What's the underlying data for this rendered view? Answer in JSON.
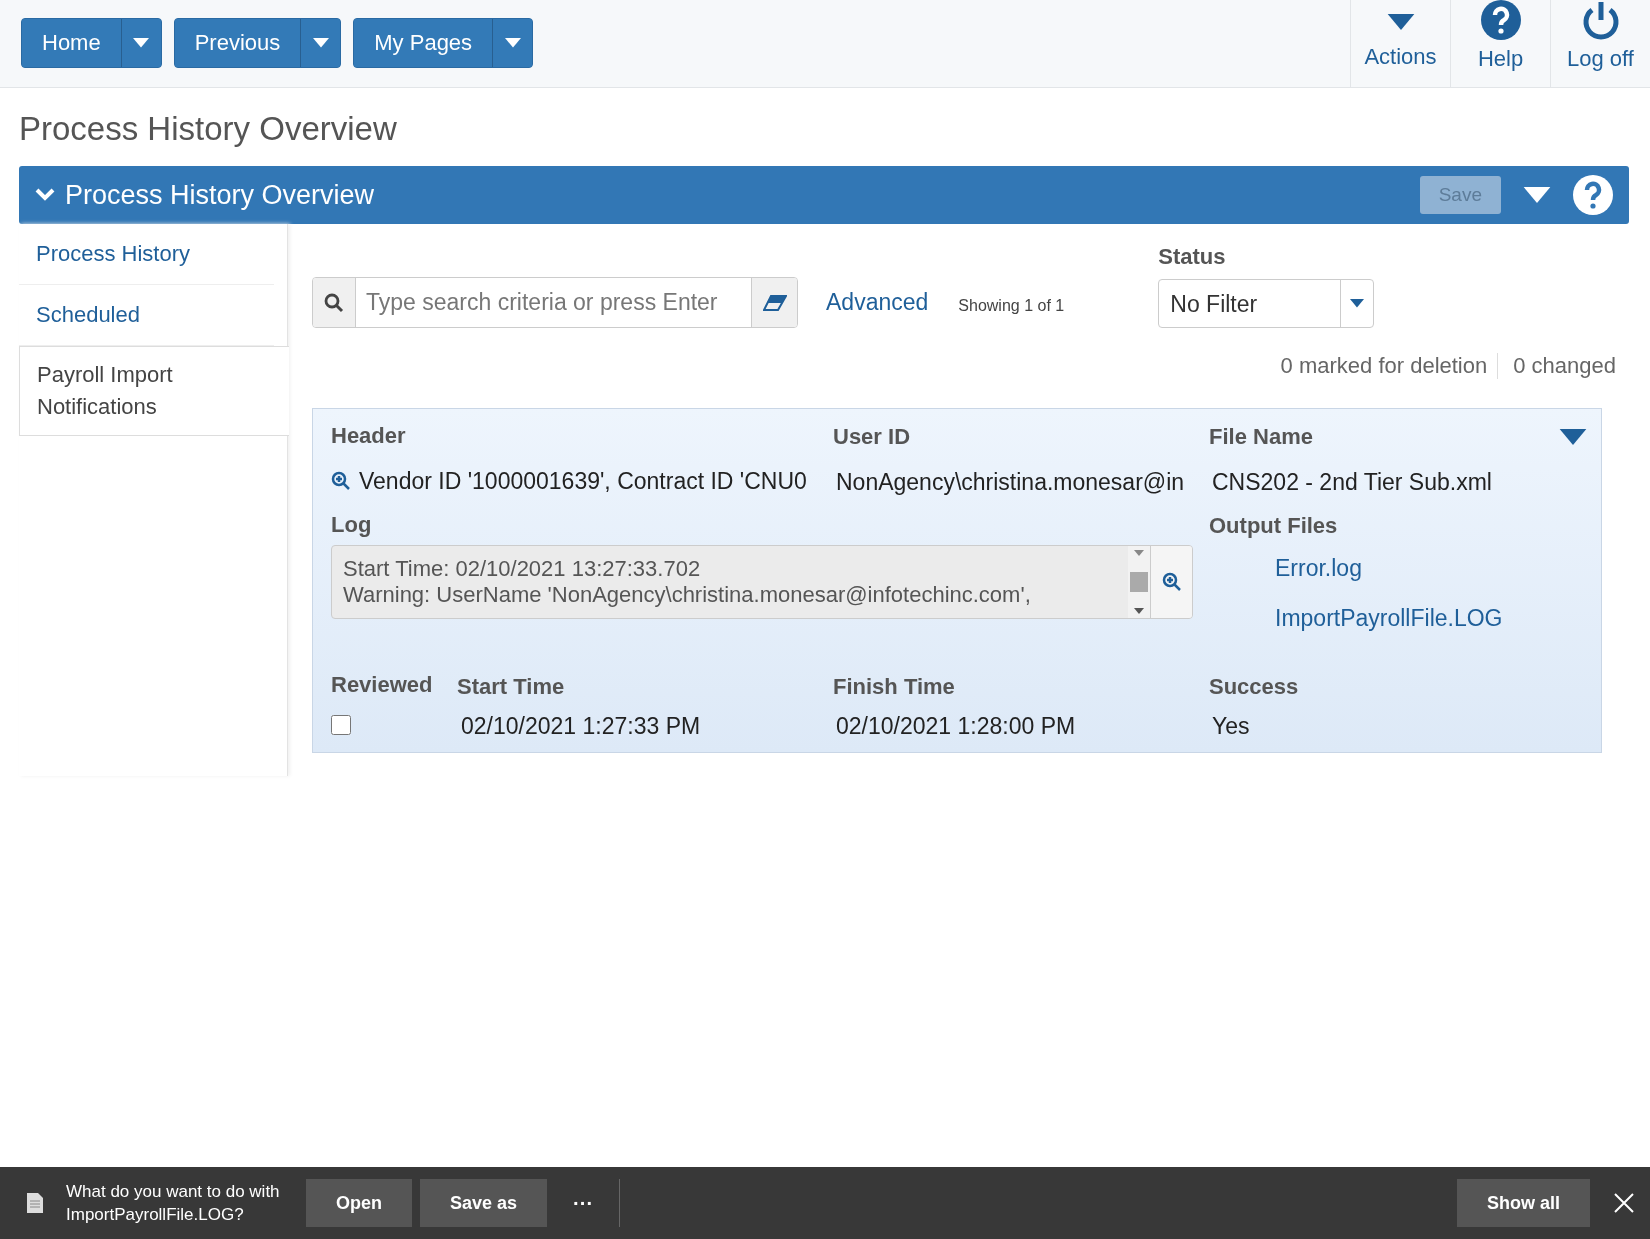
{
  "nav_buttons": [
    {
      "label": "Home"
    },
    {
      "label": "Previous"
    },
    {
      "label": "My Pages"
    }
  ],
  "top_actions": [
    {
      "kind": "caret",
      "label": "Actions"
    },
    {
      "kind": "help",
      "label": "Help"
    },
    {
      "kind": "power",
      "label": "Log off"
    }
  ],
  "page_title": "Process History Overview",
  "panel": {
    "title": "Process History Overview",
    "expanded": true,
    "save_label": "Save",
    "save_disabled": true
  },
  "sidebar": {
    "items": [
      {
        "label": "Process History",
        "selected": false
      },
      {
        "label": "Scheduled",
        "selected": false
      },
      {
        "label": "Payroll Import Notifications",
        "selected": true
      }
    ]
  },
  "search": {
    "placeholder": "Type search criteria or press Enter"
  },
  "advanced_link": "Advanced",
  "showing": "Showing 1 of 1",
  "status": {
    "label": "Status",
    "value": "No Filter"
  },
  "counts": [
    "0 marked for deletion",
    "0 changed"
  ],
  "record": {
    "header_label": "Header",
    "header_value": "Vendor ID '1000001639', Contract ID 'CNU0",
    "user_label": "User ID",
    "user_value": "NonAgency\\christina.monesar@in",
    "file_label": "File Name",
    "file_value": "CNS202 - 2nd Tier Sub.xml",
    "log_label": "Log",
    "log_lines": [
      "Start Time: 02/10/2021 13:27:33.702",
      "Warning: UserName 'NonAgency\\christina.monesar@infotechinc.com',"
    ],
    "output_label": "Output Files",
    "output_files": [
      "Error.log",
      "ImportPayrollFile.LOG"
    ],
    "reviewed_label": "Reviewed",
    "reviewed": false,
    "start_label": "Start Time",
    "start_value": "02/10/2021 1:27:33 PM",
    "finish_label": "Finish Time",
    "finish_value": "02/10/2021 1:28:00 PM",
    "success_label": "Success",
    "success_value": "Yes"
  },
  "download_bar": {
    "message": "What do you want to do with ImportPayrollFile.LOG?",
    "buttons": [
      "Open",
      "Save as"
    ],
    "more": "···",
    "show_all": "Show all"
  }
}
